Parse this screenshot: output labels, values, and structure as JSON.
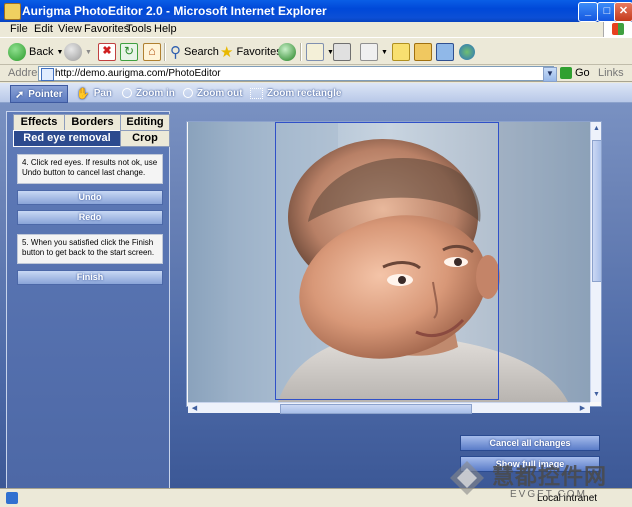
{
  "window": {
    "title": "Aurigma PhotoEditor 2.0 - Microsoft Internet Explorer"
  },
  "menu": [
    "File",
    "Edit",
    "View",
    "Favorites",
    "Tools",
    "Help"
  ],
  "toolbar": {
    "back": "Back",
    "search": "Search",
    "favorites": "Favorites"
  },
  "address": {
    "label": "Address",
    "url": "http://demo.aurigma.com/PhotoEditor",
    "go": "Go",
    "links": "Links"
  },
  "app_toolbar": [
    "Pointer",
    "Pan",
    "Zoom in",
    "Zoom out",
    "Zoom rectangle"
  ],
  "tabs_top": [
    "Effects",
    "Borders",
    "Editing"
  ],
  "tabs_bottom": [
    "Red eye removal",
    "Crop"
  ],
  "panel": {
    "hint1": "4. Click red eyes. If results not ok, use Undo button to cancel last change.",
    "undo": "Undo",
    "redo": "Redo",
    "hint2": "5. When you satisfied click the Finish button to get back to the start screen.",
    "finish": "Finish"
  },
  "right_buttons": {
    "cancel": "Cancel all changes",
    "show_full": "Show full image"
  },
  "status": {
    "zone": "Local intranet"
  },
  "watermark": {
    "cn": "慧都控件网",
    "url": "EVGET.COM"
  },
  "colors": {
    "titlebar": "#0048d8",
    "app_bg": "#5a74b0",
    "selection": "#3050c8"
  }
}
